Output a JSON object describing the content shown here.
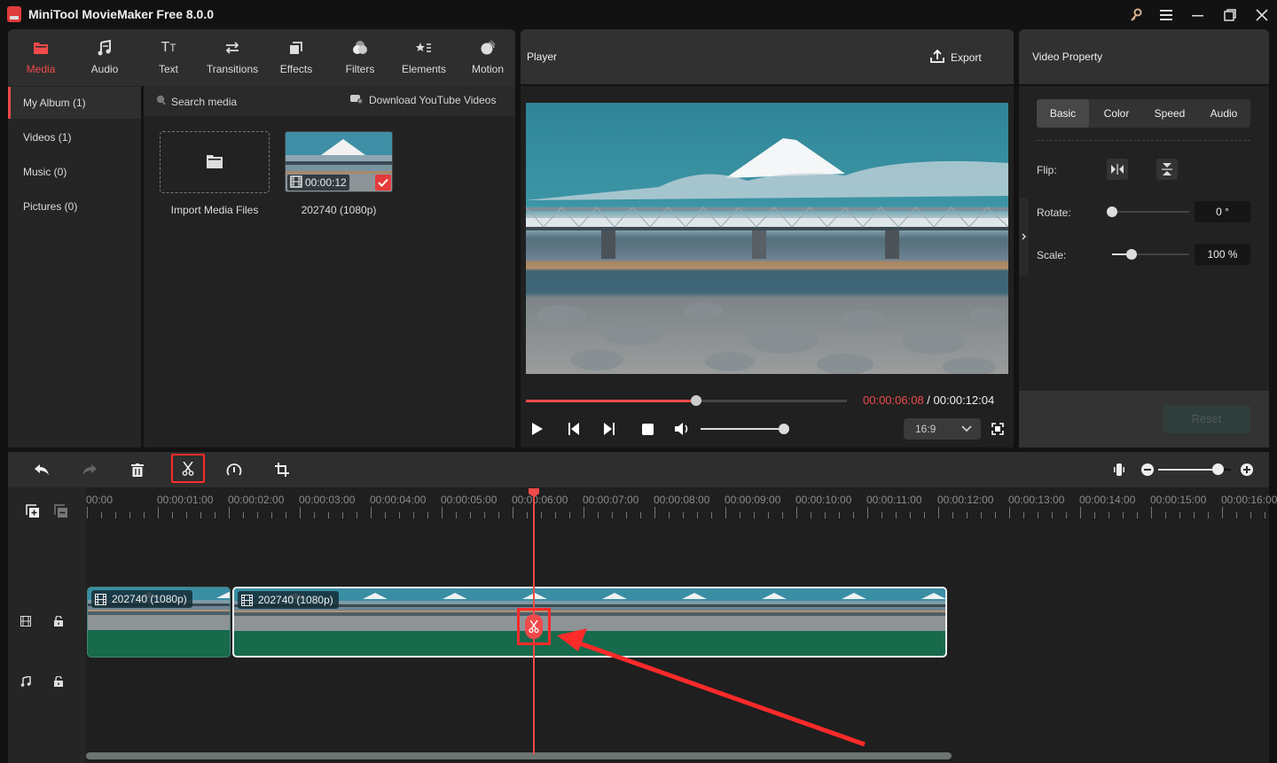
{
  "app": {
    "title": "MiniTool MovieMaker Free 8.0.0",
    "window_controls": [
      "key-icon",
      "menu-icon",
      "minimize-icon",
      "restore-icon",
      "close-icon"
    ]
  },
  "toolnav": {
    "items": [
      {
        "label": "Media",
        "icon": "folder-icon",
        "active": true
      },
      {
        "label": "Audio",
        "icon": "music-note-icon",
        "active": false
      },
      {
        "label": "Text",
        "icon": "text-icon",
        "active": false
      },
      {
        "label": "Transitions",
        "icon": "swap-arrows-icon",
        "active": false
      },
      {
        "label": "Effects",
        "icon": "layers-icon",
        "active": false
      },
      {
        "label": "Filters",
        "icon": "filters-icon",
        "active": false
      },
      {
        "label": "Elements",
        "icon": "star-list-icon",
        "active": false
      },
      {
        "label": "Motion",
        "icon": "motion-ball-icon",
        "active": false
      }
    ]
  },
  "album": {
    "items": [
      {
        "label": "My Album (1)",
        "active": true
      },
      {
        "label": "Videos (1)",
        "active": false
      },
      {
        "label": "Music (0)",
        "active": false
      },
      {
        "label": "Pictures (0)",
        "active": false
      }
    ]
  },
  "media": {
    "search_placeholder": "Search media",
    "download_label": "Download YouTube Videos",
    "import_label": "Import Media Files",
    "items": [
      {
        "name": "202740 (1080p)",
        "duration": "00:00:12",
        "selected": true
      }
    ]
  },
  "player": {
    "title": "Player",
    "export_label": "Export",
    "current_time": "00:00:06:08",
    "separator": " / ",
    "total_time": "00:00:12:04",
    "progress_fraction": 0.53,
    "volume_fraction": 1.0,
    "aspect_ratio": "16:9"
  },
  "property": {
    "title": "Video Property",
    "tabs": [
      {
        "label": "Basic",
        "active": true
      },
      {
        "label": "Color",
        "active": false
      },
      {
        "label": "Speed",
        "active": false
      },
      {
        "label": "Audio",
        "active": false
      }
    ],
    "flip_label": "Flip:",
    "rotate_label": "Rotate:",
    "rotate_value": "0 °",
    "rotate_fraction": 0.0,
    "scale_label": "Scale:",
    "scale_value": "100 %",
    "scale_fraction": 0.25,
    "reset_label": "Reset"
  },
  "timeline": {
    "toolbar": [
      "undo-icon",
      "redo-icon",
      "delete-icon",
      "split-scissors-icon",
      "speed-icon",
      "crop-icon"
    ],
    "zoom_fraction": 0.82,
    "ruler": [
      "00:00",
      "00:00:01:00",
      "00:00:02:00",
      "00:00:03:00",
      "00:00:04:00",
      "00:00:05:00",
      "00:00:06:00",
      "00:00:07:00",
      "00:00:08:00",
      "00:00:09:00",
      "00:00:10:00",
      "00:00:11:00",
      "00:00:12:00",
      "00:00:13:00",
      "00:00:14:00",
      "00:00:15:00",
      "00:00:16:00"
    ],
    "playhead_seconds": 6.3,
    "clips": [
      {
        "label": "202740 (1080p)",
        "start": 0.0,
        "end": 2.03,
        "selected": false
      },
      {
        "label": "202740 (1080p)",
        "start": 2.05,
        "end": 12.13,
        "selected": true
      }
    ]
  },
  "colors": {
    "accent": "#f04a4a",
    "clip_green": "#176a4c",
    "annotation_red": "#ff2a2a"
  }
}
